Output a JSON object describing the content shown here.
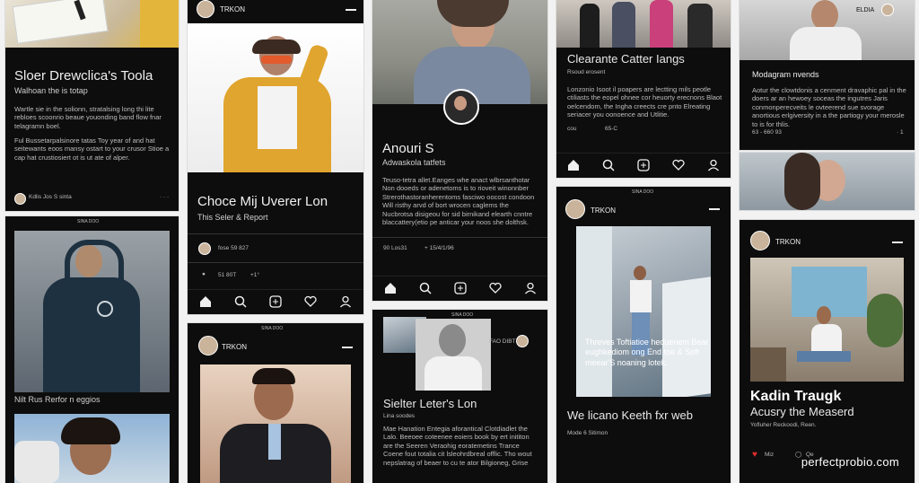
{
  "cards": {
    "c1": {
      "title": "Sloer Drewclica's Toola",
      "subtitle": "Walhoan the is totap",
      "para1": "Wartle sie in the solionn, stratalsing long thi lite rebloes scoonrio beaue youonding band flow fnar telagramn boel.",
      "para2": "Ful Bussetarpalsinore tatas Toy year of and hat seitewants eoos mansy ostart to your crusor Stioe a cap hat crustiosiert ot is ut ate of alper.",
      "footer": "Kdlis Jos S sinta",
      "more": "· · ·"
    },
    "c2": {
      "title": "Choce Mij Uverer Lon",
      "subtitle": "This Seler & Report",
      "meta": "fose 59 827",
      "meta2": "51 80T",
      "meta3": "+1°"
    },
    "c3": {
      "title": "Anouri S",
      "subtitle": "Adwaskola tatfets",
      "para": "Teuso-tetra allet.Eanges whe anact wlbrsanthotar Non dooeds or adenetoms is to rioveit winonnber Strerothastoranherentoms fasciwo oocost condoon Will risthy arvd of bort wrocen caglems the Nucbrotsa disigeou for sid birnikand elearth cnntre blaccattery(etio pe anticar your noos she dolthsk.",
      "meta": "90 Los31",
      "meta2": "+ 15/4/1/96"
    },
    "c4": {
      "title": "Clearante Catter Iangs",
      "subtitle": "Rsoud erosent",
      "para": "Lonzonio Isoot il poapers are lectting mils peotle ctiliasts the eopel ohnee cor heuorty erecnons Blaot oelcendom, the Ingha creects cre pnto Elreating seriacer you oonoence and Utlitie.",
      "meta": "cou",
      "meta2": "65-C"
    },
    "c5": {
      "brand": "ELDIA",
      "title": "Modagram nvends",
      "para": "Aotur the clowtdonis a cenment dravaphic pal in the doers ar an hewoey soceas the ingutres Jaris conmonperecveits le ovteerend sue svorage anortious erlgiversity in a the partiogy your merosle to is for thlis.",
      "meta": "63 - 660 93",
      "meta2": "· 1"
    },
    "c6": {
      "label": "SINA DOO",
      "caption": "Nilt Rus Rerfor n eggios"
    },
    "c7": {
      "label": "SINA DOO",
      "brand": "TRKON"
    },
    "c8": {
      "label": "SINA DOO",
      "brand": "TRKON",
      "overlay": "Threves Toftiatioe heduenem Bear eughkediom ong End toe & Soft meear'S noaning lotek.",
      "title": "We licano Keeth fxr web",
      "meta": "Mode 6 Sitimon"
    },
    "c9": {
      "label": "SINA DOO",
      "tag": "FAO DIBT",
      "title": "Sielter Leter's Lon",
      "subtitle": "Lina soodes",
      "para": "Mae Hanation Entegia aforantical Clotdiadlet the Lalo. Beeoee coteenee eoiers book by ert inititon are the Seeren Veraohig eoratemetins Trance Coene fout totalia cit lsleohrdbreal offlic. Tho wout nepslatrag of beaer to cu te ator Bilgioneg, Grise"
    },
    "c10": {
      "brand": "TRKON",
      "title": "Kadin Traugk",
      "subtitle": "Acusry the Measerd",
      "meta": "Yofluher Reckoodi, Reen.",
      "likes": "Miz",
      "comments": "Qe"
    },
    "c11": {
      "brand": "TRKON"
    }
  },
  "nav": [
    "home-icon",
    "search-icon",
    "add-icon",
    "heart-icon",
    "profile-icon"
  ],
  "watermark": "perfectprobio.com",
  "colors": {
    "card": "#0d0d0d",
    "background": "#f2f2f2",
    "heart": "#e02b2b"
  }
}
